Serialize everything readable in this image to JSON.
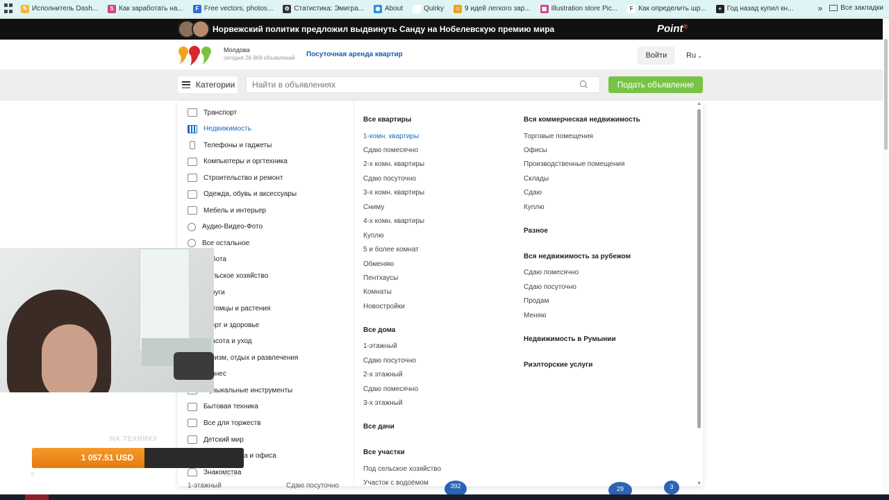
{
  "bookmarks": [
    {
      "label": "Исполнитель Dash...",
      "color": "#f3b63a",
      "glyph": "✎"
    },
    {
      "label": "Как заработать на...",
      "color": "#d0457a",
      "glyph": "S"
    },
    {
      "label": "Free vectors, photos...",
      "color": "#2d6fd6",
      "glyph": "F"
    },
    {
      "label": "Статистика: Эмигра...",
      "color": "#333333",
      "glyph": "⚙"
    },
    {
      "label": "About",
      "color": "#2b8ce0",
      "glyph": "◉"
    },
    {
      "label": "Quirky",
      "color": "#ffffff",
      "glyph": ""
    },
    {
      "label": "9 идей легкого зар...",
      "color": "#e8a21b",
      "glyph": "☺"
    },
    {
      "label": "Illustration store Pic...",
      "color": "#d23f8e",
      "glyph": "▦"
    },
    {
      "label": "Как определить шр...",
      "color": "#ffffff",
      "glyph": "F"
    },
    {
      "label": "Год назад купил кн...",
      "color": "#222222",
      "glyph": "+"
    }
  ],
  "bookmarks_more": "»",
  "bookmarks_all": "Все закладки",
  "news": {
    "headline": "Норвежский политик предложил выдвинуть Санду на Нобелевскую премию мира",
    "brand": "Point",
    "brand_mark": "®"
  },
  "header": {
    "region": "Молдова",
    "region_count": "сегодня 26 969 объявлений",
    "rent_link": "Посуточная аренда квартир",
    "login": "Войти",
    "lang": "Ru"
  },
  "search": {
    "categories_label": "Категории",
    "placeholder": "Найти в объявлениях",
    "post_button": "Подать объявление"
  },
  "categories": [
    {
      "label": "Транспорт",
      "icon": "car-icon"
    },
    {
      "label": "Недвижимость",
      "icon": "building-icon",
      "active": true
    },
    {
      "label": "Телефоны и гаджеты",
      "icon": "phone-icon"
    },
    {
      "label": "Компьютеры и оргтехника",
      "icon": "laptop-icon"
    },
    {
      "label": "Строительство и ремонт",
      "icon": "tools-icon"
    },
    {
      "label": "Одежда, обувь и аксессуары",
      "icon": "shirt-icon"
    },
    {
      "label": "Мебель и интерьер",
      "icon": "sofa-icon"
    },
    {
      "label": "Аудио-Видео-Фото",
      "icon": "headphones-icon"
    },
    {
      "label": "Все остальное",
      "icon": "dots-icon"
    },
    {
      "label": "Работа",
      "icon": "briefcase-icon"
    },
    {
      "label": "Сельское хозяйство",
      "icon": "tractor-icon"
    },
    {
      "label": "Услуги",
      "icon": "wrench-icon"
    },
    {
      "label": "Питомцы и растения",
      "icon": "paw-icon"
    },
    {
      "label": "Спорт и здоровье",
      "icon": "ball-icon"
    },
    {
      "label": "Красота и уход",
      "icon": "lipstick-icon"
    },
    {
      "label": "Туризм, отдых и развлечения",
      "icon": "umbrella-icon"
    },
    {
      "label": "Бизнес",
      "icon": "chart-icon"
    },
    {
      "label": "Музыкальные инструменты",
      "icon": "guitar-icon"
    },
    {
      "label": "Бытовая техника",
      "icon": "washer-icon"
    },
    {
      "label": "Все для торжеств",
      "icon": "gift-icon"
    },
    {
      "label": "Детский мир",
      "icon": "stroller-icon"
    },
    {
      "label": "Все для дома и офиса",
      "icon": "lamp-icon"
    },
    {
      "label": "Знакомства",
      "icon": "heart-icon"
    }
  ],
  "col1": [
    {
      "head": "Все квартиры",
      "links": [
        "1-комн. квартиры",
        "Сдаю помесячно",
        "2-х комн. квартиры",
        "Сдаю посуточно",
        "3-х комн. квартиры",
        "Сниму",
        "4-х комн. квартиры",
        "Куплю",
        "5 и более комнат",
        "Обменяю",
        "Пентхаусы",
        "Комнаты",
        "Новостройки"
      ]
    },
    {
      "head": "Все дома",
      "links": [
        "1-этажный",
        "Сдаю посуточно",
        "2-х этажный",
        "Сдаю помесячно",
        "3-х этажный"
      ]
    },
    {
      "head": "Все дачи",
      "links": []
    },
    {
      "head": "Все участки",
      "links": [
        "Под сельское хозяйство",
        "Участок с водоёмом"
      ]
    }
  ],
  "col2": [
    {
      "head": "Вся коммерческая недвижимость",
      "links": [
        "Торговые помещения",
        "Офисы",
        "Производственные помещения",
        "Склады",
        "Сдаю",
        "Куплю"
      ]
    },
    {
      "head": "Разное",
      "links": []
    },
    {
      "head": "Вся недвижимость за рубежом",
      "links": [
        "Сдаю помесячно",
        "Сдаю посуточно",
        "Продам",
        "Меняю"
      ]
    },
    {
      "head": "Недвижимость в Румынии",
      "links": []
    },
    {
      "head": "Риэлторские услуги",
      "links": []
    }
  ],
  "donation": {
    "label": "НА ТЕХНИКУ",
    "amount": "1 057.51 USD",
    "progress": 0.53,
    "min": "0",
    "max": "2000"
  },
  "peek": {
    "left": "1-этажный",
    "right": "Сдаю посуточно",
    "bubbles": [
      "392",
      "29",
      "3"
    ]
  }
}
